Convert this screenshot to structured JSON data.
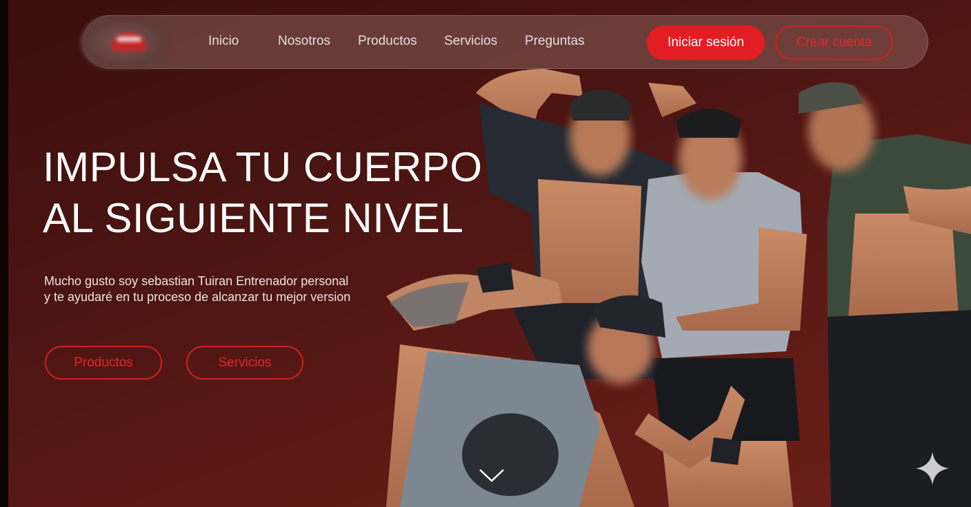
{
  "nav": {
    "links": [
      "Inicio",
      "Nosotros",
      "Productos",
      "Servicios",
      "Preguntas"
    ],
    "login_label": "Iniciar sesión",
    "register_label": "Crear cuenta"
  },
  "hero": {
    "title_line1": "IMPULSA TU CUERPO",
    "title_line2": "AL SIGUIENTE NIVEL",
    "subtitle_line1": "Mucho gusto soy sebastian Tuiran Entrenador personal",
    "subtitle_line2": "y te ayudaré en tu proceso de alcanzar tu mejor version",
    "buttons": [
      "Productos",
      "Servicios"
    ]
  },
  "icons": {
    "logo": "gym-logo-icon",
    "scroll": "chevron-down-icon",
    "sparkle": "sparkle-icon"
  },
  "colors": {
    "accent": "#e21d23",
    "background": "#4a1412",
    "text": "#ffffff"
  }
}
